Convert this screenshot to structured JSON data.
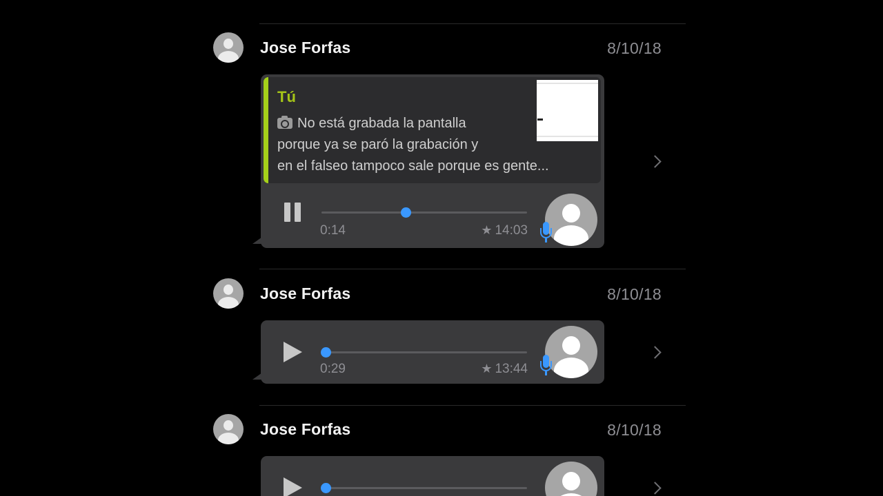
{
  "chats": [
    {
      "sender": "Jose Forfas",
      "date": "8/10/18",
      "quote": {
        "author": "Tú",
        "lines": [
          "No está grabada la pantalla",
          "porque ya se paró la grabación y",
          "en el falseo tampoco sale porque es gente..."
        ]
      },
      "audio": {
        "state": "playing",
        "elapsed": "0:14",
        "time": "14:03",
        "progress": 0.41
      }
    },
    {
      "sender": "Jose Forfas",
      "date": "8/10/18",
      "audio": {
        "state": "paused",
        "elapsed": "0:29",
        "time": "13:44",
        "progress": 0.02
      }
    },
    {
      "sender": "Jose Forfas",
      "date": "8/10/18",
      "audio": {
        "state": "paused",
        "elapsed": "",
        "time": "",
        "progress": 0.02
      }
    }
  ],
  "icons": {
    "star": "★",
    "quote_media": "camera-icon",
    "audio_source": "microphone-icon",
    "open": "chevron-right-icon"
  },
  "colors": {
    "accent": "#3a98ff",
    "quote_bar": "#a5d11a",
    "quote_author": "#a5c418",
    "bubble": "#3a3a3c",
    "background": "#000000"
  }
}
